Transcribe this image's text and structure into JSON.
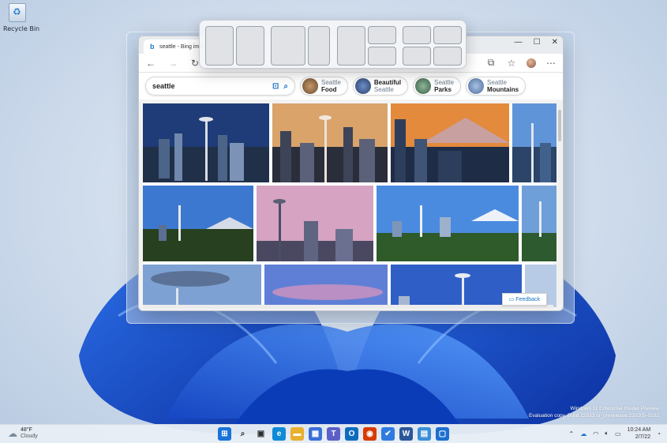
{
  "desktop": {
    "recycle_bin_label": "Recycle Bin"
  },
  "browser": {
    "tab_title": "seattle - Bing imag",
    "window_controls": [
      "—",
      "☐",
      "✕"
    ],
    "search_query": "seattle",
    "chips": [
      {
        "line1": "Seattle",
        "line2": "Food",
        "color": "#8b6a4a"
      },
      {
        "line1": "Beautiful",
        "line2": "Seattle",
        "color": "#3f5f8f",
        "bold_first": true
      },
      {
        "line1": "Seattle",
        "line2": "Parks",
        "color": "#4f7a5c"
      },
      {
        "line1": "Seattle",
        "line2": "Mountains",
        "color": "#5e7fa8"
      }
    ],
    "feedback_label": "Feedback"
  },
  "watermark": {
    "line1": "Windows 11 Enterprise Insider Preview",
    "line2": "Evaluation copy. Build 22533.rs_prerelease.220205-0102"
  },
  "taskbar": {
    "temperature": "48°F",
    "condition": "Cloudy",
    "apps": [
      {
        "name": "start",
        "glyph": "⊞",
        "color": "#1a73d9"
      },
      {
        "name": "search",
        "glyph": "⌕",
        "color": "#2b2b2b"
      },
      {
        "name": "task-view",
        "glyph": "▣",
        "color": "#2b2b2b"
      },
      {
        "name": "edge",
        "glyph": "e",
        "color": "#0f8bd6"
      },
      {
        "name": "file-explorer",
        "glyph": "▬",
        "color": "#e8b02f"
      },
      {
        "name": "store",
        "glyph": "▦",
        "color": "#3a6fd8"
      },
      {
        "name": "teams",
        "glyph": "T",
        "color": "#5b5fc7"
      },
      {
        "name": "outlook",
        "glyph": "O",
        "color": "#0f6cbd"
      },
      {
        "name": "office",
        "glyph": "◉",
        "color": "#d83b01"
      },
      {
        "name": "todo",
        "glyph": "✔",
        "color": "#2f7be0"
      },
      {
        "name": "word",
        "glyph": "W",
        "color": "#2b579a"
      },
      {
        "name": "notepad",
        "glyph": "▤",
        "color": "#3b8ed6"
      },
      {
        "name": "remote-desktop",
        "glyph": "▢",
        "color": "#1c6fcf"
      }
    ],
    "time": "10:24 AM",
    "date": "2/7/22"
  }
}
